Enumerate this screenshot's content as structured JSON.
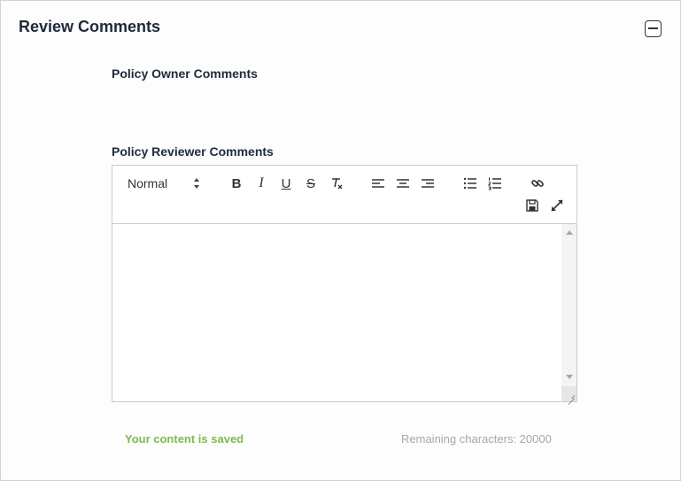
{
  "panel": {
    "title": "Review Comments",
    "collapse_icon": "minus-square-icon"
  },
  "owner_comments": {
    "label": "Policy Owner Comments"
  },
  "reviewer_comments": {
    "label": "Policy Reviewer Comments",
    "editor": {
      "format_select": "Normal",
      "toolbar": {
        "icons": [
          "bold-icon",
          "italic-icon",
          "underline-icon",
          "strikethrough-icon",
          "clear-format-icon",
          "align-left-icon",
          "align-center-icon",
          "align-right-icon",
          "bullet-list-icon",
          "numbered-list-icon",
          "link-icon",
          "save-icon",
          "expand-icon"
        ],
        "bold_glyph": "B",
        "italic_glyph": "I",
        "underline_glyph": "U",
        "strike_glyph": "S"
      },
      "content": ""
    }
  },
  "status": {
    "saved": "Your content is saved",
    "remaining": "Remaining characters: 20000"
  },
  "colors": {
    "saved_text": "#7dbb4f",
    "muted_text": "#a5a8ad",
    "heading_text": "#1f2a3a"
  }
}
